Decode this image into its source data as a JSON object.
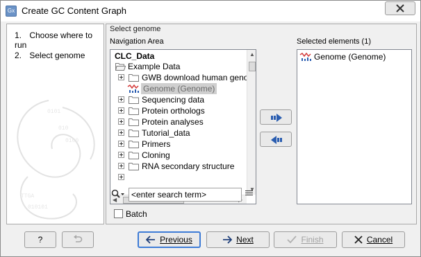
{
  "window": {
    "title": "Create GC Content Graph",
    "app_icon_text": "Gx"
  },
  "steps": [
    {
      "num": "1.",
      "label": "Choose where to run"
    },
    {
      "num": "2.",
      "label": "Select genome"
    }
  ],
  "main": {
    "section_title": "Select genome",
    "navigation_label": "Navigation Area",
    "selected_label": "Selected elements (1)"
  },
  "tree": {
    "root": "CLC_Data",
    "items": [
      {
        "label": "Example Data",
        "icon": "folder-open-icon",
        "expander": "minus"
      },
      {
        "label": "GWB download human genome",
        "icon": "folder-icon",
        "expander": "plus"
      },
      {
        "label": "Genome (Genome)",
        "icon": "sequence-icon",
        "expander": "",
        "selected": true
      },
      {
        "label": "Sequencing data",
        "icon": "folder-icon",
        "expander": "plus"
      },
      {
        "label": "Protein orthologs",
        "icon": "folder-icon",
        "expander": "plus"
      },
      {
        "label": "Protein analyses",
        "icon": "folder-icon",
        "expander": "plus"
      },
      {
        "label": "Tutorial_data",
        "icon": "folder-icon",
        "expander": "plus"
      },
      {
        "label": "Primers",
        "icon": "folder-icon",
        "expander": "plus"
      },
      {
        "label": "Cloning",
        "icon": "folder-icon",
        "expander": "plus"
      },
      {
        "label": "RNA secondary structure",
        "icon": "folder-icon",
        "expander": "plus"
      }
    ]
  },
  "search": {
    "value": "<enter search term>"
  },
  "batch": {
    "label": "Batch",
    "checked": false
  },
  "selected_elements": [
    {
      "label": "Genome (Genome)",
      "icon": "sequence-icon"
    }
  ],
  "footer": {
    "help_label": "?",
    "previous_label": "Previous",
    "next_label": "Next",
    "finish_label": "Finish",
    "cancel_label": "Cancel"
  },
  "colors": {
    "accent_blue": "#2a5db0",
    "default_button_border": "#3d7bd6",
    "cancel_red": "#333333"
  }
}
